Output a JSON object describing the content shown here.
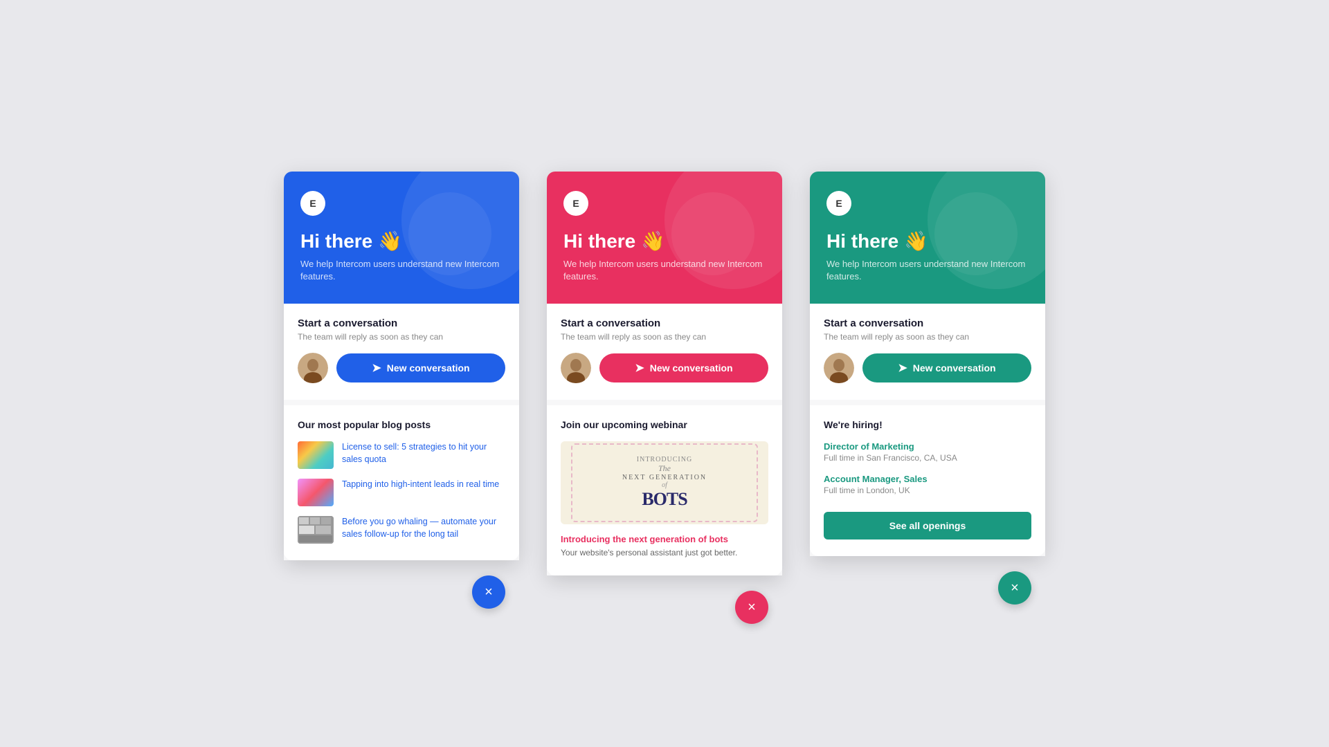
{
  "widgets": [
    {
      "id": "blue",
      "color": "blue",
      "accent": "#2060e8",
      "logo": "E",
      "greeting": "Hi there 👋",
      "subtitle": "We help Intercom users understand new Intercom features.",
      "conversation": {
        "title": "Start a conversation",
        "subtitle": "The team will reply as soon as they can",
        "button_label": "New conversation"
      },
      "section_type": "blog",
      "section_title": "Our most popular blog posts",
      "blog_posts": [
        {
          "title": "License to sell: 5 strategies to hit your sales quota",
          "thumb_class": "thumb-1"
        },
        {
          "title": "Tapping into high-intent leads in real time",
          "thumb_class": "thumb-2"
        },
        {
          "title": "Before you go whaling — automate your sales follow-up for the long tail",
          "thumb_class": "thumb-3"
        }
      ],
      "close_label": "×"
    },
    {
      "id": "pink",
      "color": "pink",
      "accent": "#e83060",
      "logo": "E",
      "greeting": "Hi there 👋",
      "subtitle": "We help Intercom users understand new Intercom features.",
      "conversation": {
        "title": "Start a conversation",
        "subtitle": "The team will reply as soon as they can",
        "button_label": "New conversation"
      },
      "section_type": "webinar",
      "section_title": "Join our upcoming webinar",
      "webinar": {
        "image_text": "INTRODUCING The NEXT GENERATION of BOTS",
        "link": "Introducing the next generation of bots",
        "description": "Your website's personal assistant just got better."
      },
      "close_label": "×"
    },
    {
      "id": "teal",
      "color": "teal",
      "accent": "#1a9980",
      "logo": "E",
      "greeting": "Hi there 👋",
      "subtitle": "We help Intercom users understand new Intercom features.",
      "conversation": {
        "title": "Start a conversation",
        "subtitle": "The team will reply as soon as they can",
        "button_label": "New conversation"
      },
      "section_type": "jobs",
      "section_title": "We're hiring!",
      "jobs": [
        {
          "title": "Director of Marketing",
          "meta": "Full time in San Francisco, CA, USA"
        },
        {
          "title": "Account Manager, Sales",
          "meta": "Full time in London, UK"
        }
      ],
      "see_all_label": "See all openings",
      "close_label": "×"
    }
  ]
}
